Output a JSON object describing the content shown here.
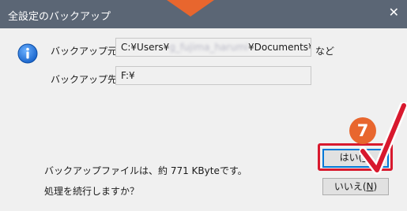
{
  "dialog": {
    "title": "全設定のバックアップ",
    "source_label": "バックアップ元",
    "source_path_prefix": "C:¥Users¥",
    "source_path_redacted": "g_fujima_harumi",
    "source_path_suffix": "¥Documents¥",
    "source_suffix_text": "など",
    "dest_label": "バックアップ先",
    "dest_path": "F:¥",
    "size_message": "バックアップファイルは、約 771 KByteです。",
    "confirm_message": "処理を続行しますか？"
  },
  "buttons": {
    "yes_label": "はい(",
    "yes_mnemonic": "Y",
    "yes_close": ")",
    "no_label": "いいえ(",
    "no_mnemonic": "N",
    "no_close": ")"
  },
  "annotation": {
    "step_number": "7",
    "accent_color": "#e8662e",
    "highlight_color": "#d8192e"
  },
  "icons": {
    "close": "close-icon",
    "info": "info-icon",
    "check": "check-mark-icon"
  }
}
